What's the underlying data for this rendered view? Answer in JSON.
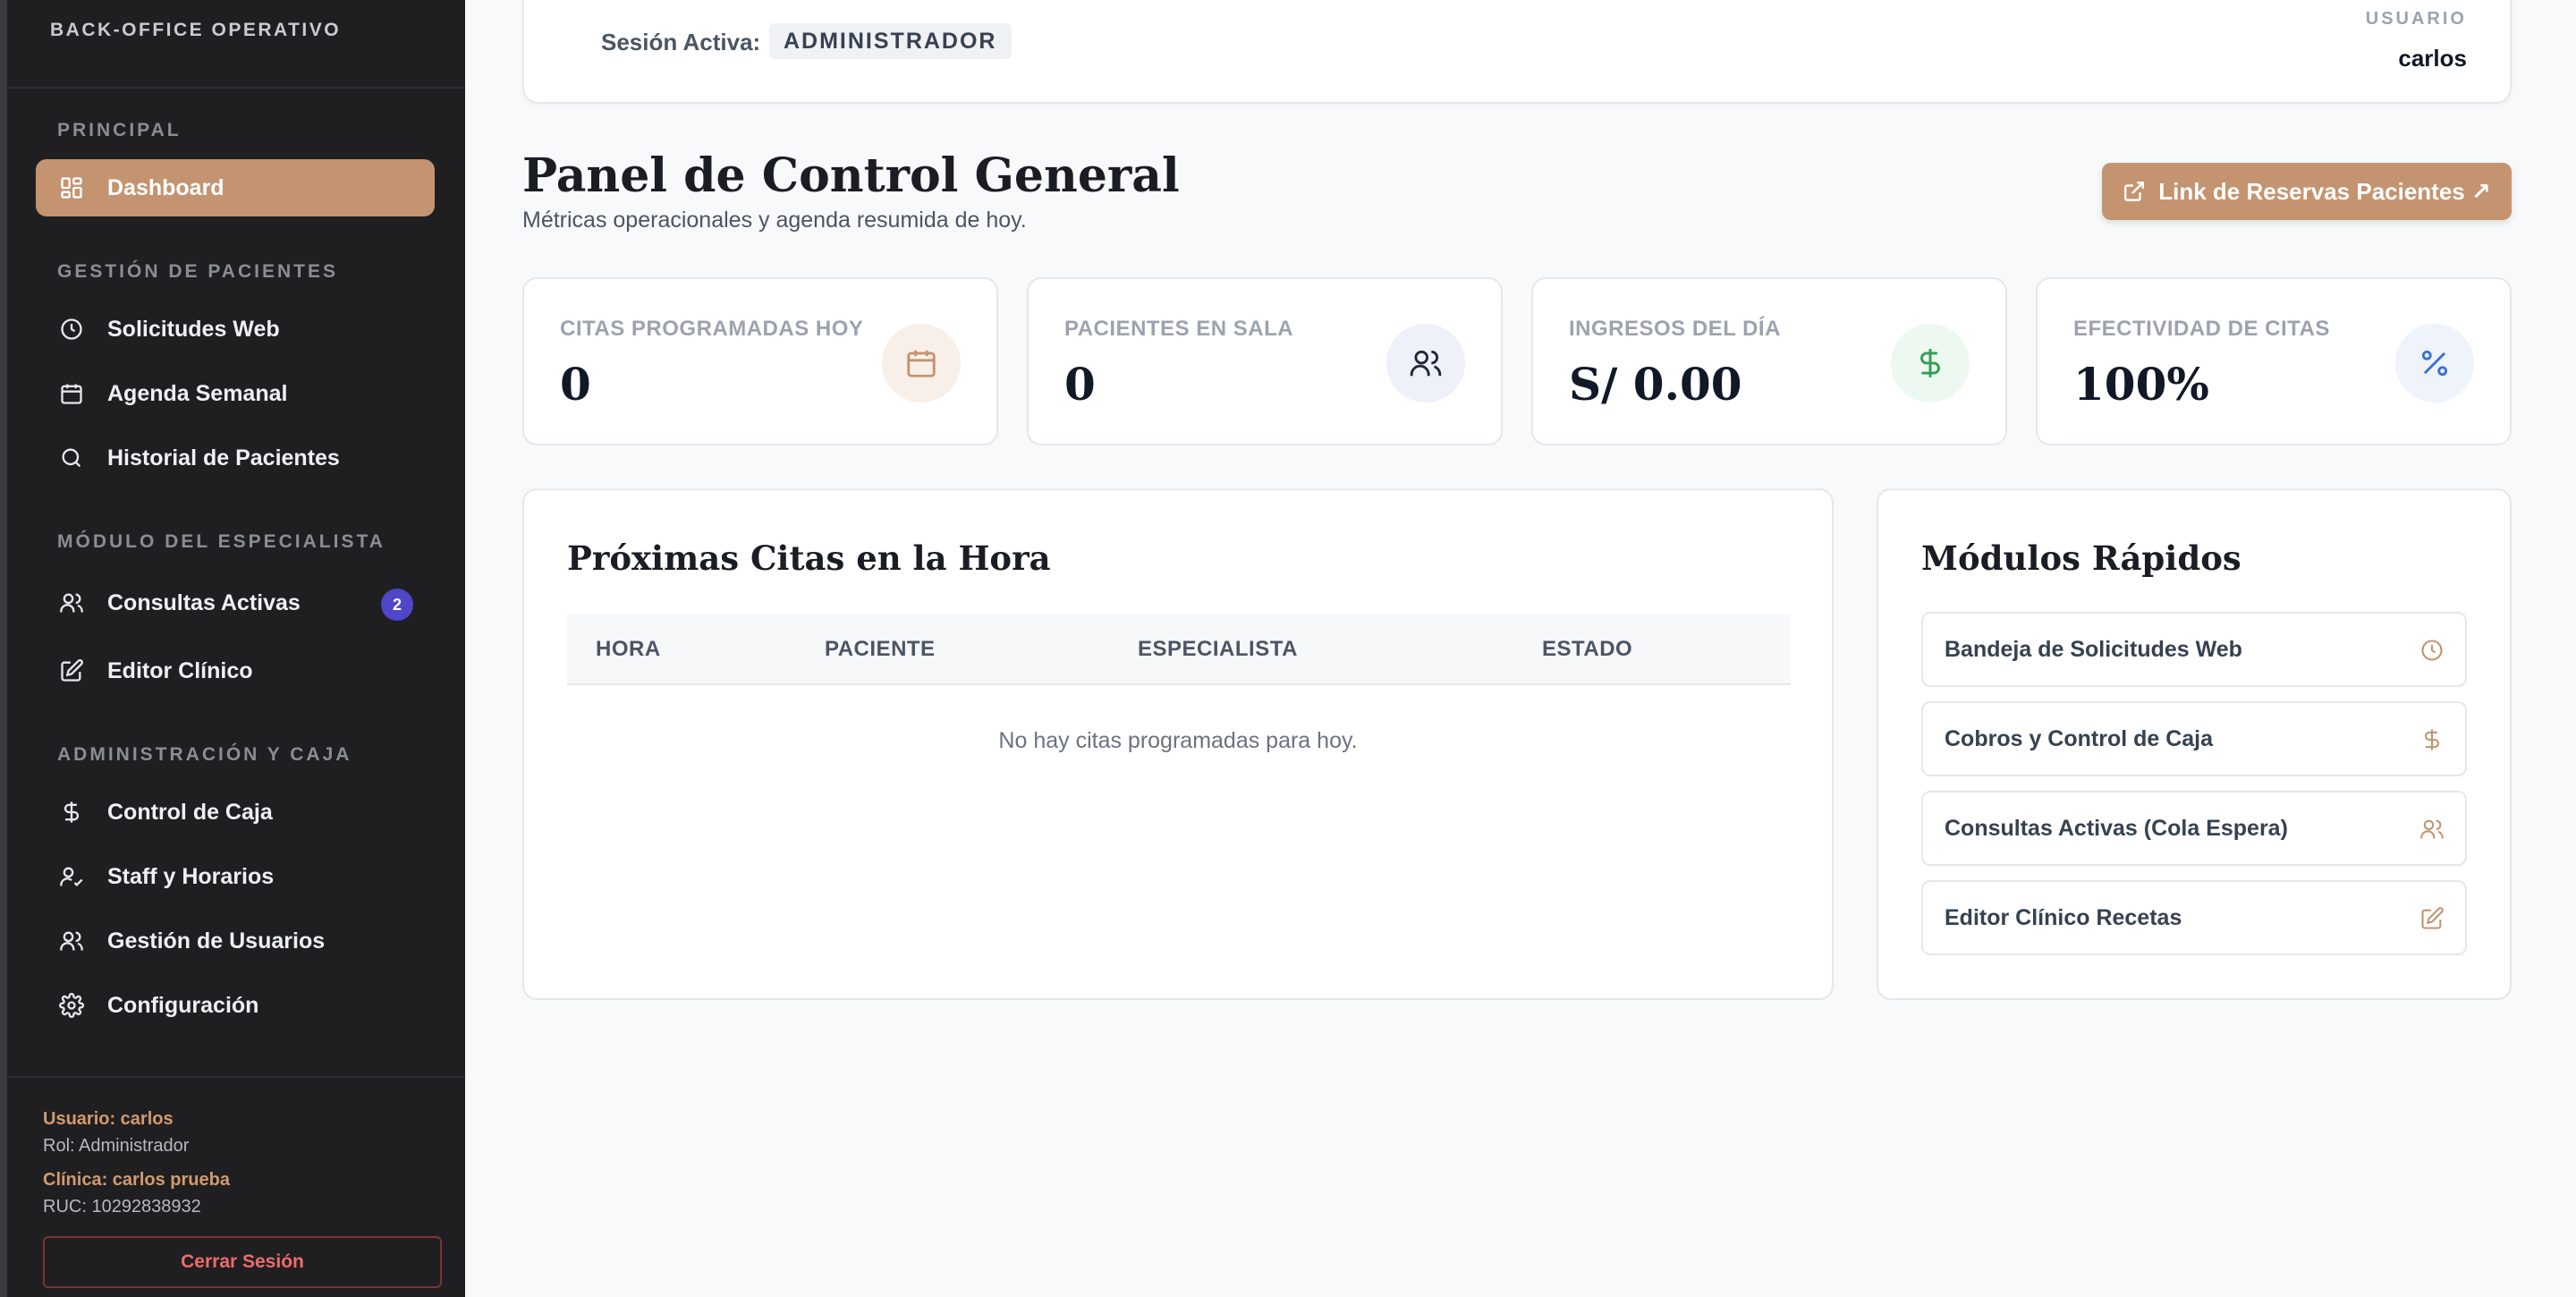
{
  "sidebar": {
    "brand": "BACK-OFFICE OPERATIVO",
    "sections": [
      {
        "title": "PRINCIPAL"
      },
      {
        "title": "GESTIÓN DE PACIENTES"
      },
      {
        "title": "MÓDULO DEL ESPECIALISTA"
      },
      {
        "title": "ADMINISTRACIÓN Y CAJA"
      }
    ],
    "items": [
      {
        "label": "Dashboard",
        "icon": "dashboard-grid-icon",
        "active": true
      },
      {
        "label": "Solicitudes Web",
        "icon": "clock-icon"
      },
      {
        "label": "Agenda Semanal",
        "icon": "calendar-icon"
      },
      {
        "label": "Historial de Pacientes",
        "icon": "search-icon"
      },
      {
        "label": "Consultas Activas",
        "icon": "users-icon",
        "badge": "2"
      },
      {
        "label": "Editor Clínico",
        "icon": "edit-icon"
      },
      {
        "label": "Control de Caja",
        "icon": "dollar-icon"
      },
      {
        "label": "Staff y Horarios",
        "icon": "user-check-icon"
      },
      {
        "label": "Gestión de Usuarios",
        "icon": "users-icon"
      },
      {
        "label": "Configuración",
        "icon": "gear-icon"
      }
    ],
    "footer": {
      "user": "Usuario: carlos",
      "role": "Rol: Administrador",
      "clinic": "Clínica: carlos prueba",
      "ruc": "RUC: 10292838932",
      "logout": "Cerrar Sesión"
    }
  },
  "topbar": {
    "session_label": "Sesión Activa:",
    "session_value": "ADMINISTRADOR",
    "user_caption": "USUARIO",
    "user_name": "carlos"
  },
  "header": {
    "title": "Panel de Control General",
    "subtitle": "Métricas operacionales y agenda resumida de hoy.",
    "cta_label": "Link de Reservas Pacientes ↗"
  },
  "stats": [
    {
      "caption": "CITAS PROGRAMADAS HOY",
      "value": "0",
      "icon": "calendar-icon",
      "color": "#c49470",
      "bg": "#f8efe8"
    },
    {
      "caption": "PACIENTES EN SALA",
      "value": "0",
      "icon": "users-icon",
      "color": "#1f2937",
      "bg": "#eef0fa"
    },
    {
      "caption": "INGRESOS DEL DÍA",
      "value": "S/ 0.00",
      "icon": "dollar-icon",
      "color": "#2f9e52",
      "bg": "#edf8f0"
    },
    {
      "caption": "EFECTIVIDAD DE CITAS",
      "value": "100%",
      "icon": "percent-icon",
      "color": "#3b6fd6",
      "bg": "#eef3fc"
    }
  ],
  "appointments": {
    "title": "Próximas Citas en la Hora",
    "columns": [
      "HORA",
      "PACIENTE",
      "ESPECIALISTA",
      "ESTADO"
    ],
    "empty_text": "No hay citas programadas para hoy."
  },
  "quick_modules": {
    "title": "Módulos Rápidos",
    "items": [
      {
        "label": "Bandeja de Solicitudes Web",
        "icon": "clock-icon"
      },
      {
        "label": "Cobros y Control de Caja",
        "icon": "dollar-icon"
      },
      {
        "label": "Consultas Activas (Cola Espera)",
        "icon": "users-icon"
      },
      {
        "label": "Editor Clínico Recetas",
        "icon": "edit-icon"
      }
    ]
  },
  "colors": {
    "accent": "#c49470",
    "sidebar_bg": "#1f1f22",
    "badge": "#4f46c9",
    "danger": "#ef6b6b"
  }
}
